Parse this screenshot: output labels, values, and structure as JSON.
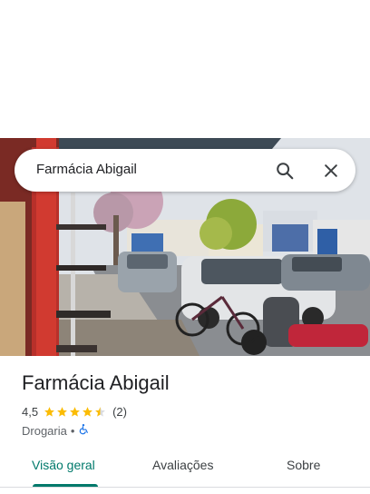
{
  "search": {
    "query": "Farmácia Abigail"
  },
  "icons": {
    "search": "search-icon",
    "close": "close-icon",
    "accessibility": "wheelchair-icon",
    "star": "star-icon"
  },
  "place": {
    "name": "Farmácia Abigail",
    "rating": "4,5",
    "rating_value": 4.5,
    "review_count": "(2)",
    "category": "Drogaria",
    "separator": "•"
  },
  "tabs": [
    {
      "label": "Visão geral",
      "active": true
    },
    {
      "label": "Avaliações",
      "active": false
    },
    {
      "label": "Sobre",
      "active": false
    }
  ],
  "colors": {
    "accent": "#00796b",
    "star": "#fbbc04",
    "accessibility": "#1a73e8"
  }
}
